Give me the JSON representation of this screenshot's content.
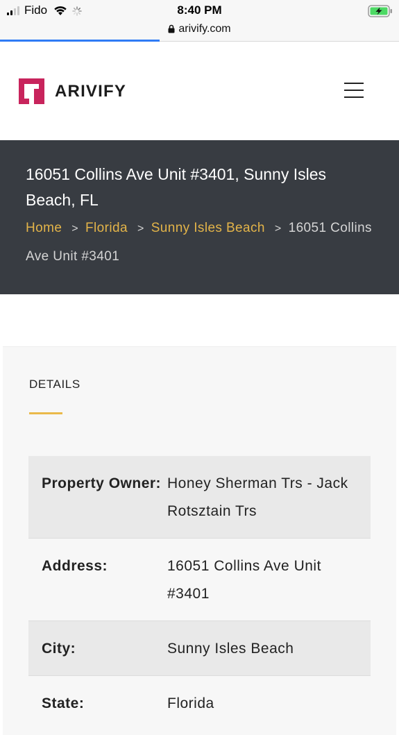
{
  "status_bar": {
    "carrier": "Fido",
    "time": "8:40 PM"
  },
  "browser": {
    "url": "arivify.com",
    "load_progress_pct": 40
  },
  "site": {
    "logo_text": "ARIVIFY",
    "brand_color": "#c8245c",
    "accent_color": "#e3b449"
  },
  "hero": {
    "title": "16051 Collins Ave Unit #3401, Sunny Isles Beach, FL",
    "breadcrumb": {
      "home": "Home",
      "state": "Florida",
      "city": "Sunny Isles Beach",
      "separator": ">",
      "current": "16051 Collins Ave Unit #3401"
    }
  },
  "details": {
    "heading": "DETAILS",
    "rows": [
      {
        "label": "Property Owner:",
        "value": "Honey Sherman Trs - Jack Rotsztain Trs"
      },
      {
        "label": "Address:",
        "value": "16051 Collins Ave Unit #3401"
      },
      {
        "label": "City:",
        "value": "Sunny Isles Beach"
      },
      {
        "label": "State:",
        "value": "Florida"
      }
    ]
  }
}
